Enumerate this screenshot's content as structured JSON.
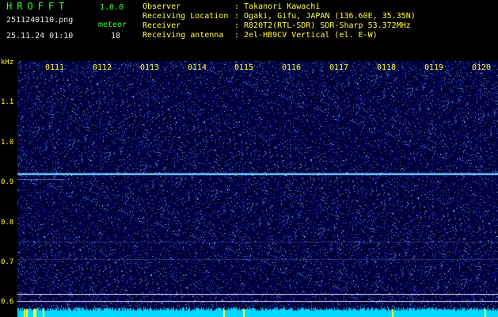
{
  "header": {
    "app_name": "HROFFT",
    "version": "1.0.0",
    "filename": "2511240110.png",
    "datetime": "25.11.24 01:10",
    "meteor_label": "meteor",
    "meteor_count": "18",
    "meta": [
      {
        "key": "Observer",
        "sep": ":",
        "value": "Takanori Kawachi"
      },
      {
        "key": "Receiving Location",
        "sep": ":",
        "value": "Ogaki, Gifu, JAPAN (136.60E, 35.35N)"
      },
      {
        "key": "Receiver",
        "sep": ":",
        "value": "R820T2(RTL-SDR) SDR-Sharp 53.372MHz"
      },
      {
        "key": "Receiving antenna",
        "sep": ":",
        "value": "2el-HB9CV Vertical (el. E-W)"
      }
    ]
  },
  "axis": {
    "unit": "kHz",
    "y_ticks": [
      "1.1",
      "1.0",
      "0.9",
      "0.8",
      "0.7",
      "0.6"
    ],
    "x_ticks": [
      "0111",
      "0112",
      "0113",
      "0114",
      "0115",
      "0116",
      "0117",
      "0118",
      "0119",
      "0120"
    ]
  },
  "colors": {
    "background": "#000000",
    "spectrogram_base": "#0a0a6e",
    "carrier_line": "#6fc8ff",
    "baseline": "#00d8ff",
    "text_green": "#33ff33",
    "text_yellow": "#ffff33"
  }
}
